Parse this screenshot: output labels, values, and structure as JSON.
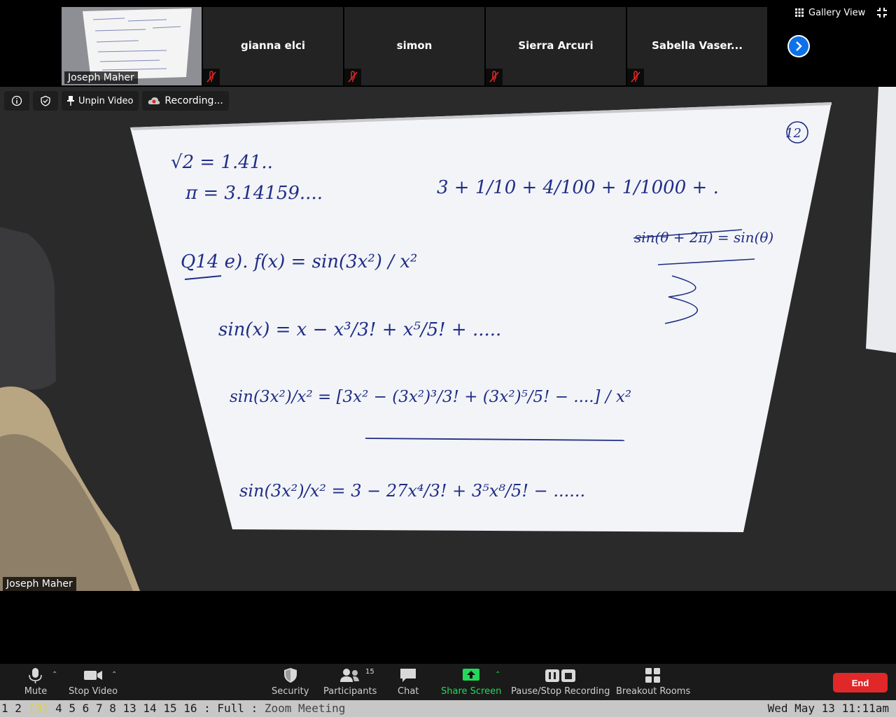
{
  "gallery": {
    "self": {
      "name": "Joseph Maher"
    },
    "participants": [
      {
        "name": "gianna elci",
        "muted": true
      },
      {
        "name": "simon",
        "muted": true
      },
      {
        "name": "Sierra Arcuri",
        "muted": true
      },
      {
        "name": "Sabella Vaser...",
        "muted": true
      }
    ],
    "view_label": "Gallery View"
  },
  "main_video": {
    "speaker_name": "Joseph Maher",
    "unpin_label": "Unpin Video",
    "recording_label": "Recording...",
    "whiteboard": {
      "page_number": "12",
      "lines": [
        "√2 = 1.41..",
        "π = 3.14159....",
        "3 + 1/10 + 4/100 + 1/1000 + .",
        "Q14 e).  f(x) = sin(3x²) / x²",
        "sin(x) = x − x³/3! + x⁵/5! + .....",
        "sin(3x²)/x² = [3x² − (3x²)³/3! + (3x²)⁵/5! − ....] / x²",
        "sin(3x²)/x² = 3 − 27x⁴/3! + 3⁵x⁸/5! − ......",
        "sin(θ + 2π) = sin(θ)"
      ]
    }
  },
  "controls": {
    "mute": "Mute",
    "stop_video": "Stop Video",
    "security": "Security",
    "participants": "Participants",
    "participants_count": "15",
    "chat": "Chat",
    "share_screen": "Share Screen",
    "pause_stop_recording": "Pause/Stop Recording",
    "breakout_rooms": "Breakout Rooms",
    "end": "End"
  },
  "statusbar": {
    "workspaces": [
      "1",
      "2",
      "3",
      "4",
      "5",
      "6",
      "7",
      "8",
      "13",
      "14",
      "15",
      "16"
    ],
    "active_workspace": "3",
    "layout": "Full",
    "window_title": "Zoom Meeting",
    "clock": "Wed May 13 11:11am"
  },
  "colors": {
    "accent_blue": "#0e71eb",
    "share_green": "#23d959",
    "end_red": "#e02828",
    "ink_blue": "#1f2d86",
    "ink_red": "#d6282b"
  }
}
